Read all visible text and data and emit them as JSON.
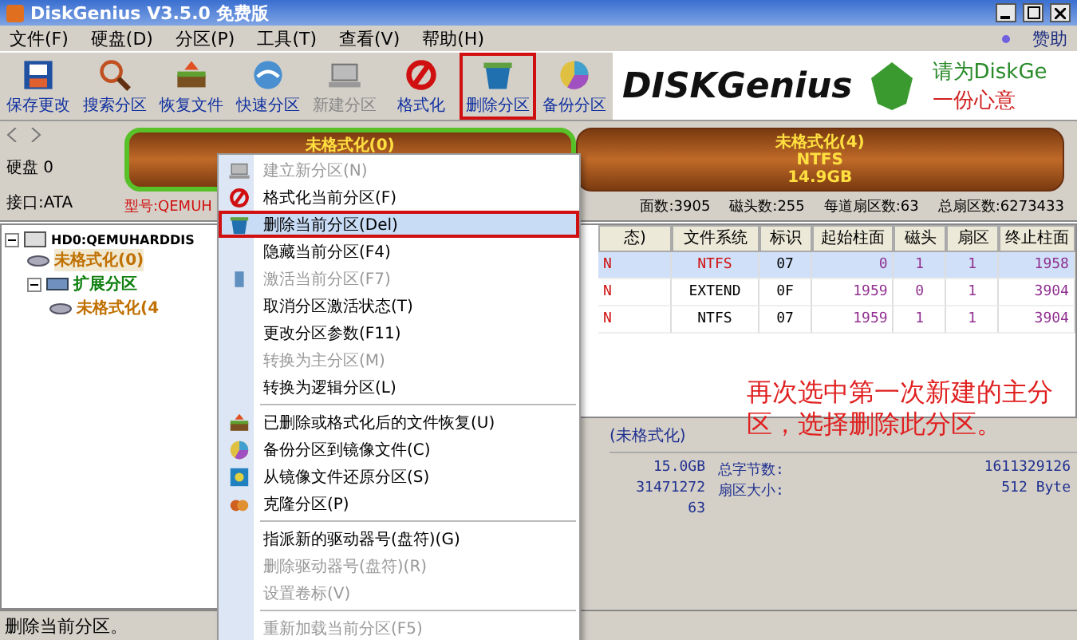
{
  "window": {
    "title": "DiskGenius V3.5.0 免费版"
  },
  "menu": [
    "文件(F)",
    "硬盘(D)",
    "分区(P)",
    "工具(T)",
    "查看(V)",
    "帮助(H)"
  ],
  "sponsor": "赞助",
  "toolbar": [
    {
      "label": "保存更改",
      "disabled": false,
      "highlighted": false
    },
    {
      "label": "搜索分区",
      "disabled": false,
      "highlighted": false
    },
    {
      "label": "恢复文件",
      "disabled": false,
      "highlighted": false
    },
    {
      "label": "快速分区",
      "disabled": false,
      "highlighted": false
    },
    {
      "label": "新建分区",
      "disabled": true,
      "highlighted": false
    },
    {
      "label": "格式化",
      "disabled": false,
      "highlighted": false
    },
    {
      "label": "删除分区",
      "disabled": false,
      "highlighted": true
    },
    {
      "label": "备份分区",
      "disabled": false,
      "highlighted": false
    }
  ],
  "banner": {
    "logo": "DISKGenius",
    "slogan_1": "请为DiskGe",
    "slogan_2": "一份心意"
  },
  "disk": {
    "label": "硬盘 0",
    "interface": "接口:ATA",
    "model": "型号:QEMUH",
    "partitions": [
      {
        "lines": [
          "未格式化(0)"
        ],
        "selected": true
      },
      {
        "lines": [
          "未格式化(4)",
          "NTFS",
          "14.9GB"
        ],
        "selected": false
      }
    ],
    "info": [
      "面数:3905",
      "磁头数:255",
      "每道扇区数:63",
      "总扇区数:6273433"
    ]
  },
  "tree": [
    {
      "label": "HD0:QEMUHARDDIS",
      "kind": "disk",
      "selected": false,
      "children": [
        {
          "label": "未格式化(0)",
          "kind": "partition",
          "selected": true
        },
        {
          "label": "扩展分区",
          "kind": "extended",
          "selected": false,
          "children": [
            {
              "label": "未格式化(4",
              "kind": "partition",
              "selected": false
            }
          ]
        }
      ]
    }
  ],
  "table": {
    "columns": [
      "态)",
      "文件系统",
      "标识",
      "起始柱面",
      "磁头",
      "扇区",
      "终止柱面"
    ],
    "rows": [
      {
        "selected": true,
        "cells": [
          "N",
          "NTFS",
          "07",
          "0",
          "1",
          "1",
          "1958"
        ]
      },
      {
        "selected": false,
        "cells": [
          "N",
          "EXTEND",
          "0F",
          "1959",
          "0",
          "1",
          "3904"
        ]
      },
      {
        "selected": false,
        "cells": [
          "N",
          "NTFS",
          "07",
          "1959",
          "1",
          "1",
          "3904"
        ]
      }
    ]
  },
  "details": {
    "title": "(未格式化)",
    "values": [
      "15.0GB",
      "31471272",
      "63"
    ],
    "fields": [
      {
        "label": "总字节数:",
        "value": "1611329126"
      },
      {
        "label": "扇区大小:",
        "value": "512 Byte"
      }
    ]
  },
  "annotation": "再次选中第一次新建的主分区，选择删除此分区。",
  "context_menu": [
    {
      "kind": "item",
      "label": "建立新分区(N)",
      "disabled": true,
      "selected": false
    },
    {
      "kind": "item",
      "label": "格式化当前分区(F)",
      "disabled": false,
      "selected": false
    },
    {
      "kind": "item",
      "label": "删除当前分区(Del)",
      "disabled": false,
      "selected": true
    },
    {
      "kind": "item",
      "label": "隐藏当前分区(F4)",
      "disabled": false,
      "selected": false
    },
    {
      "kind": "item",
      "label": "激活当前分区(F7)",
      "disabled": true,
      "selected": false
    },
    {
      "kind": "item",
      "label": "取消分区激活状态(T)",
      "disabled": false,
      "selected": false
    },
    {
      "kind": "item",
      "label": "更改分区参数(F11)",
      "disabled": false,
      "selected": false
    },
    {
      "kind": "item",
      "label": "转换为主分区(M)",
      "disabled": true,
      "selected": false
    },
    {
      "kind": "item",
      "label": "转换为逻辑分区(L)",
      "disabled": false,
      "selected": false
    },
    {
      "kind": "separator"
    },
    {
      "kind": "item",
      "label": "已删除或格式化后的文件恢复(U)",
      "disabled": false,
      "selected": false
    },
    {
      "kind": "item",
      "label": "备份分区到镜像文件(C)",
      "disabled": false,
      "selected": false
    },
    {
      "kind": "item",
      "label": "从镜像文件还原分区(S)",
      "disabled": false,
      "selected": false
    },
    {
      "kind": "item",
      "label": "克隆分区(P)",
      "disabled": false,
      "selected": false
    },
    {
      "kind": "separator"
    },
    {
      "kind": "item",
      "label": "指派新的驱动器号(盘符)(G)",
      "disabled": false,
      "selected": false
    },
    {
      "kind": "item",
      "label": "删除驱动器号(盘符)(R)",
      "disabled": true,
      "selected": false
    },
    {
      "kind": "item",
      "label": "设置卷标(V)",
      "disabled": true,
      "selected": false
    },
    {
      "kind": "separator"
    },
    {
      "kind": "item",
      "label": "重新加载当前分区(F5)",
      "disabled": true,
      "selected": false
    }
  ],
  "status_bar": "删除当前分区。"
}
